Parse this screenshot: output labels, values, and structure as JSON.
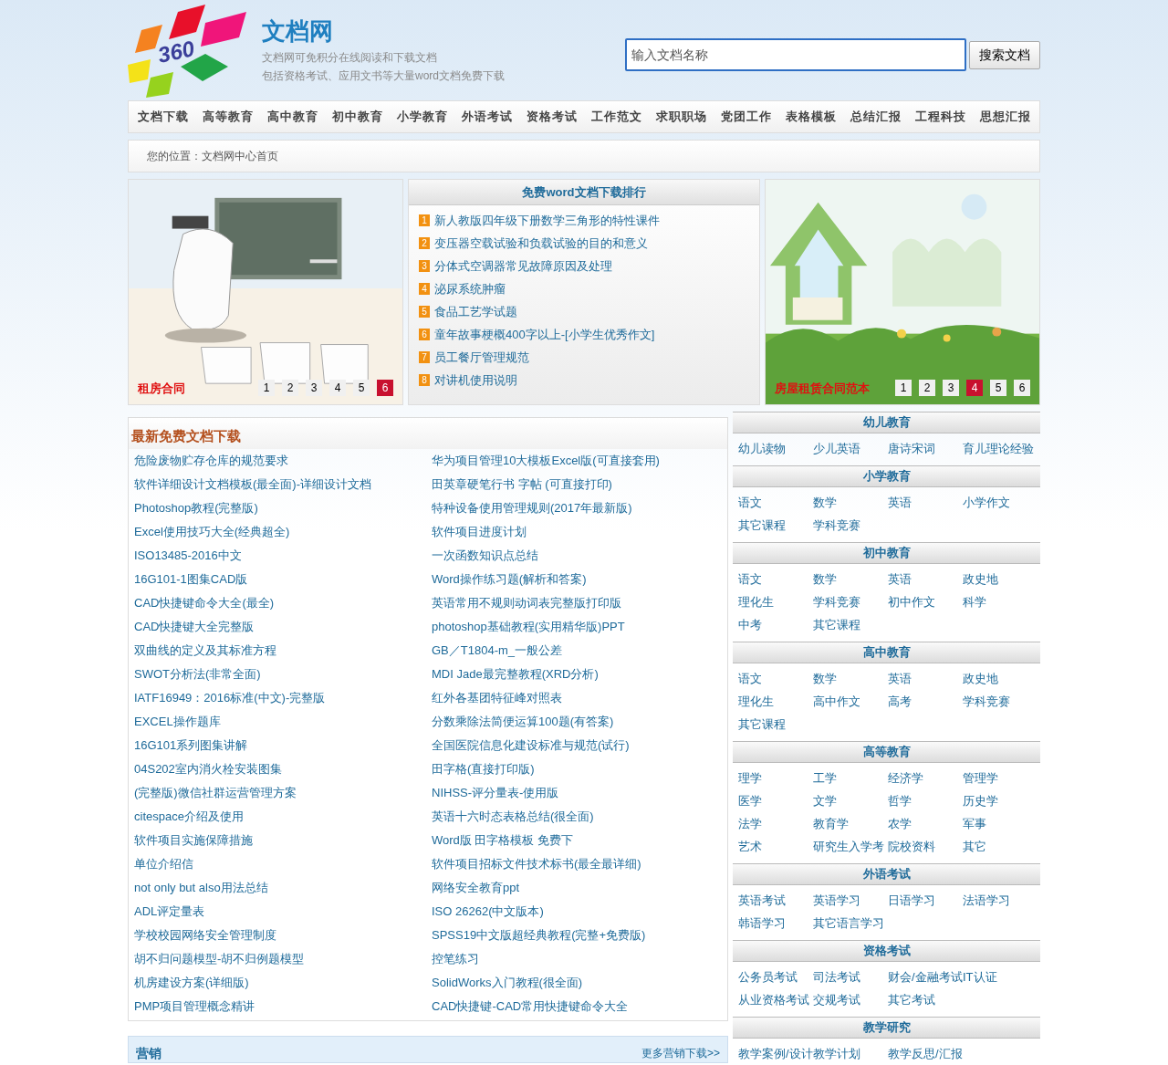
{
  "header": {
    "logo_badge": "360",
    "site_title": "文档网",
    "tagline": [
      "文档网可免积分在线阅读和下载文档",
      "包括资格考试、应用文书等大量word文档免费下载"
    ],
    "search": {
      "placeholder": "输入文档名称",
      "button": "搜索文档"
    }
  },
  "nav": [
    "文档下载",
    "高等教育",
    "高中教育",
    "初中教育",
    "小学教育",
    "外语考试",
    "资格考试",
    "工作范文",
    "求职职场",
    "党团工作",
    "表格模板",
    "总结汇报",
    "工程科技",
    "思想汇报"
  ],
  "breadcrumb": "您的位置：文档网中心首页",
  "slides": [
    {
      "caption": "租房合同",
      "pages": [
        {
          "label": "1",
          "selected": false
        },
        {
          "label": "2",
          "selected": false
        },
        {
          "label": "3",
          "selected": false
        },
        {
          "label": "4",
          "selected": false
        },
        {
          "label": "5",
          "selected": false
        },
        {
          "label": "6",
          "selected": true
        }
      ]
    },
    {
      "caption": "房屋租赁合同范本",
      "pages": [
        {
          "label": "1",
          "selected": false
        },
        {
          "label": "2",
          "selected": false
        },
        {
          "label": "3",
          "selected": false
        },
        {
          "label": "4",
          "selected": true
        },
        {
          "label": "5",
          "selected": false
        },
        {
          "label": "6",
          "selected": false
        }
      ]
    }
  ],
  "ranking": {
    "title": "免费word文档下载排行",
    "items": [
      {
        "rank": "1",
        "title": "新人教版四年级下册数学三角形的特性课件"
      },
      {
        "rank": "2",
        "title": "变压器空载试验和负载试验的目的和意义"
      },
      {
        "rank": "3",
        "title": "分体式空调器常见故障原因及处理"
      },
      {
        "rank": "4",
        "title": "泌尿系统肿瘤"
      },
      {
        "rank": "5",
        "title": "食品工艺学试题"
      },
      {
        "rank": "6",
        "title": "童年故事梗概400字以上-[小学生优秀作文]"
      },
      {
        "rank": "7",
        "title": "员工餐厅管理规范"
      },
      {
        "rank": "8",
        "title": "对讲机使用说明"
      }
    ]
  },
  "latest": {
    "title": "最新免费文档下载",
    "links": [
      "危险废物贮存仓库的规范要求",
      "华为项目管理10大模板Excel版(可直接套用)",
      "软件详细设计文档模板(最全面)-详细设计文档",
      "田英章硬笔行书 字帖 (可直接打印)",
      "Photoshop教程(完整版)",
      "特种设备使用管理规则(2017年最新版)",
      "Excel使用技巧大全(经典超全)",
      "软件项目进度计划",
      "ISO13485-2016中文",
      "一次函数知识点总结",
      "16G101-1图集CAD版",
      "Word操作练习题(解析和答案)",
      "CAD快捷键命令大全(最全)",
      "英语常用不规则动词表完整版打印版",
      "CAD快捷键大全完整版",
      "photoshop基础教程(实用精华版)PPT",
      "双曲线的定义及其标准方程",
      "GB／T1804-m_一般公差",
      "SWOT分析法(非常全面)",
      "MDI Jade最完整教程(XRD分析)",
      "IATF16949：2016标准(中文)-完整版",
      "红外各基团特征峰对照表",
      "EXCEL操作题库",
      "分数乘除法简便运算100题(有答案)",
      "16G101系列图集讲解",
      "全国医院信息化建设标准与规范(试行)",
      "04S202室内消火栓安装图集",
      "田字格(直接打印版)",
      "(完整版)微信社群运营管理方案",
      "NIHSS-评分量表-使用版",
      "citespace介绍及使用",
      "英语十六时态表格总结(很全面)",
      "软件项目实施保障措施",
      "Word版 田字格模板 免费下",
      "单位介绍信",
      "软件项目招标文件技术标书(最全最详细)",
      "not only but also用法总结",
      "网络安全教育ppt",
      "ADL评定量表",
      "ISO 26262(中文版本)",
      "学校校园网络安全管理制度",
      "SPSS19中文版超经典教程(完整+免费版)",
      "胡不归问题模型-胡不归例题模型",
      "控笔练习",
      "机房建设方案(详细版)",
      "SolidWorks入门教程(很全面)",
      "PMP项目管理概念精讲",
      "CAD快捷键-CAD常用快捷键命令大全"
    ]
  },
  "marketing": {
    "title": "营销",
    "more": "更多营销下载>>"
  },
  "categories": [
    {
      "title": "幼儿教育",
      "items": [
        "幼儿读物",
        "少儿英语",
        "唐诗宋词",
        "育儿理论经验"
      ]
    },
    {
      "title": "小学教育",
      "items": [
        "语文",
        "数学",
        "英语",
        "小学作文",
        "其它课程",
        "学科竞赛"
      ]
    },
    {
      "title": "初中教育",
      "items": [
        "语文",
        "数学",
        "英语",
        "政史地",
        "理化生",
        "学科竞赛",
        "初中作文",
        "科学",
        "中考",
        "其它课程"
      ]
    },
    {
      "title": "高中教育",
      "items": [
        "语文",
        "数学",
        "英语",
        "政史地",
        "理化生",
        "高中作文",
        "高考",
        "学科竞赛",
        "其它课程"
      ]
    },
    {
      "title": "高等教育",
      "items": [
        "理学",
        "工学",
        "经济学",
        "管理学",
        "医学",
        "文学",
        "哲学",
        "历史学",
        "法学",
        "教育学",
        "农学",
        "军事",
        "艺术",
        "研究生入学考",
        "院校资料",
        "其它"
      ]
    },
    {
      "title": "外语考试",
      "items": [
        "英语考试",
        "英语学习",
        "日语学习",
        "法语学习",
        "韩语学习",
        "其它语言学习"
      ]
    },
    {
      "title": "资格考试",
      "items": [
        "公务员考试",
        "司法考试",
        "财会/金融考试",
        "IT认证",
        "从业资格考试",
        "交规考试",
        "其它考试"
      ]
    },
    {
      "title": "教学研究",
      "items": [
        "教学案例/设计",
        "教学计划",
        "教学反思/汇报"
      ]
    }
  ]
}
